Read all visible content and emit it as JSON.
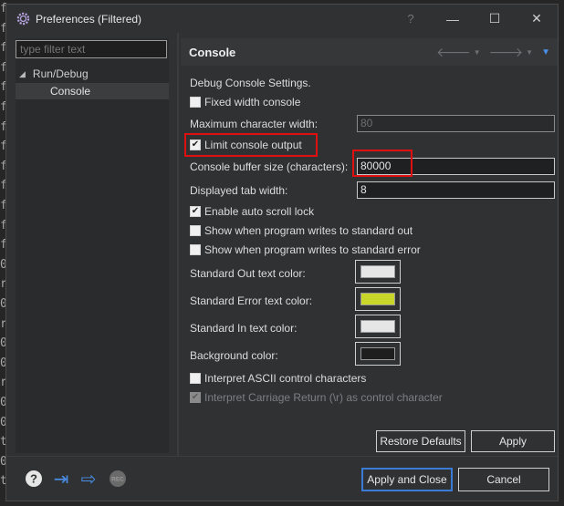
{
  "window": {
    "title": "Preferences (Filtered)",
    "help_glyph": "?",
    "minimize_glyph": "—",
    "maximize_glyph": "☐",
    "close_glyph": "✕"
  },
  "tree": {
    "filter_placeholder": "type filter text",
    "expand_glyph": "◢",
    "parent_label": "Run/Debug",
    "child_label": "Console"
  },
  "page": {
    "title": "Console",
    "nav_back_glyph": "🡐",
    "nav_forward_glyph": "🡒",
    "nav_dropdown_glyph": "▼",
    "nav_menu_glyph": "▼",
    "intro": "Debug Console Settings.",
    "fixed_width": {
      "label": "Fixed width console",
      "checked": false
    },
    "max_char_width": {
      "label": "Maximum character width:",
      "value": "80"
    },
    "limit_output": {
      "label": "Limit console output",
      "checked": true
    },
    "buffer_size": {
      "label": "Console buffer size (characters):",
      "value": "80000"
    },
    "tab_width": {
      "label": "Displayed tab width:",
      "value": "8"
    },
    "auto_scroll": {
      "label": "Enable auto scroll lock",
      "checked": true
    },
    "show_stdout": {
      "label": "Show when program writes to standard out",
      "checked": false
    },
    "show_stderr": {
      "label": "Show when program writes to standard error",
      "checked": false
    },
    "stdout_color": {
      "label": "Standard Out text color:",
      "color": "#e6e6e6"
    },
    "stderr_color": {
      "label": "Standard Error text color:",
      "color": "#c8d62a"
    },
    "stdin_color": {
      "label": "Standard In text color:",
      "color": "#e6e6e6"
    },
    "bg_color": {
      "label": "Background color:",
      "color": "#1e1e1e"
    },
    "interpret_ascii": {
      "label": "Interpret ASCII control characters",
      "checked": false
    },
    "interpret_cr": {
      "label": "Interpret Carriage Return (\\r) as control character",
      "checked": true,
      "disabled": true
    },
    "check_glyph": "✔",
    "restore_defaults": "Restore Defaults",
    "apply": "Apply"
  },
  "footer": {
    "help_icon": "?",
    "import_icon": "⇥",
    "export_icon": "⇨",
    "record_icon": "REC",
    "apply_and_close": "Apply and Close",
    "cancel": "Cancel"
  },
  "background": {
    "left_chars": [
      "f",
      "f",
      "f",
      "f",
      "f",
      "f",
      "f",
      "f",
      "f",
      "f",
      "f",
      "f",
      "f",
      "0",
      "r",
      "0",
      "r",
      "0",
      "0",
      "r",
      "0",
      "0",
      "t",
      "0",
      "t"
    ]
  }
}
